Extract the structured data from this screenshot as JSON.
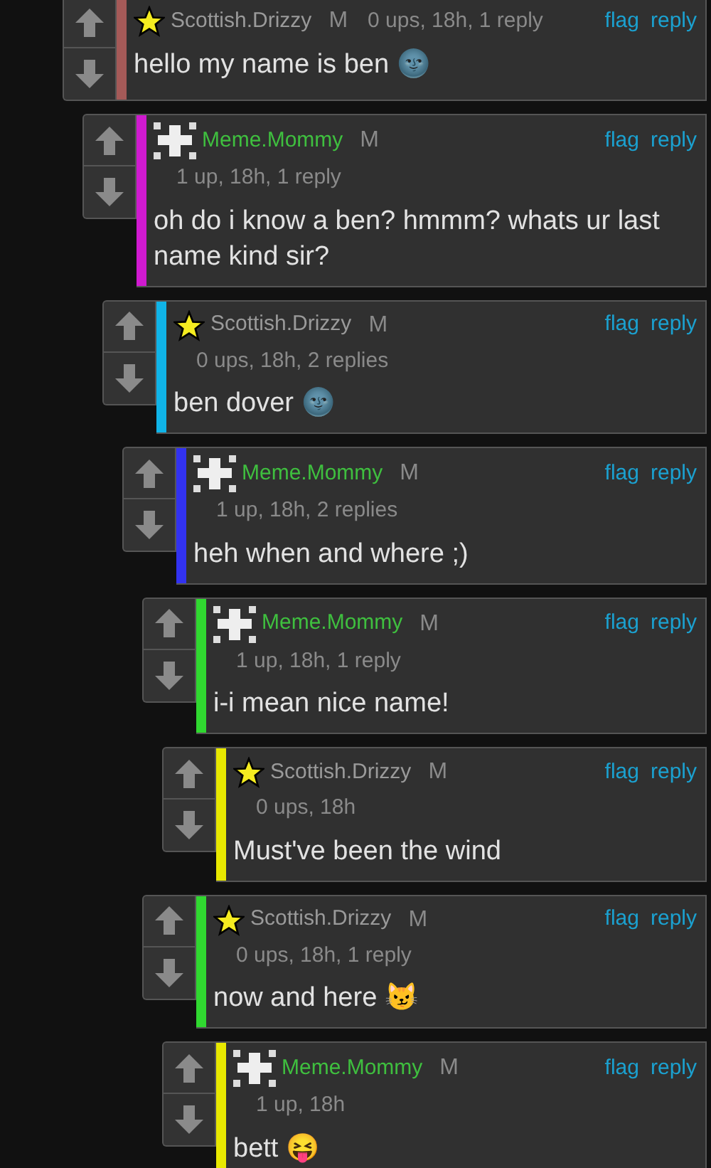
{
  "comments": [
    {
      "author": "Scottish.Drizzy",
      "avatar": {
        "kind": "star"
      },
      "tag": "M",
      "meta": "0 ups, 18h, 1 reply",
      "meta_inline": true,
      "color": "#a55a58",
      "text": "hello my name is ben 🌚",
      "actions": [
        "flag",
        "reply"
      ],
      "children": [
        {
          "author": "Meme.Mommy",
          "avatar": {
            "kind": "pixel"
          },
          "tag": "M",
          "meta": "1 up, 18h, 1 reply",
          "meta_inline": false,
          "color": "#d01ad0",
          "text": "oh do i know a ben? hmmm? whats ur last name kind sir?",
          "actions": [
            "flag",
            "reply"
          ],
          "children": [
            {
              "author": "Scottish.Drizzy",
              "avatar": {
                "kind": "star"
              },
              "tag": "M",
              "meta": "0 ups, 18h, 2 replies",
              "meta_inline": false,
              "color": "#10b4e8",
              "text": "ben dover 🌚",
              "actions": [
                "flag",
                "reply"
              ],
              "children": [
                {
                  "author": "Meme.Mommy",
                  "avatar": {
                    "kind": "pixel"
                  },
                  "tag": "M",
                  "meta": "1 up, 18h, 2 replies",
                  "meta_inline": false,
                  "color": "#3232f0",
                  "text": "heh when and where ;)",
                  "actions": [
                    "flag",
                    "reply"
                  ],
                  "children": [
                    {
                      "author": "Meme.Mommy",
                      "avatar": {
                        "kind": "pixel"
                      },
                      "tag": "M",
                      "meta": "1 up, 18h, 1 reply",
                      "meta_inline": false,
                      "color": "#30d830",
                      "text": "i-i mean nice name!",
                      "actions": [
                        "flag",
                        "reply"
                      ],
                      "children": [
                        {
                          "author": "Scottish.Drizzy",
                          "avatar": {
                            "kind": "star"
                          },
                          "tag": "M",
                          "meta": "0 ups, 18h",
                          "meta_inline": false,
                          "color": "#e8e800",
                          "text": "Must've been the wind",
                          "actions": [
                            "flag",
                            "reply"
                          ]
                        }
                      ]
                    },
                    {
                      "author": "Scottish.Drizzy",
                      "avatar": {
                        "kind": "star"
                      },
                      "tag": "M",
                      "meta": "0 ups, 18h, 1 reply",
                      "meta_inline": false,
                      "color": "#30d830",
                      "text": "now and here 😼",
                      "actions": [
                        "flag",
                        "reply"
                      ],
                      "children": [
                        {
                          "author": "Meme.Mommy",
                          "avatar": {
                            "kind": "pixel"
                          },
                          "tag": "M",
                          "meta": "1 up, 18h",
                          "meta_inline": false,
                          "color": "#e8e800",
                          "text": "bett 😝",
                          "actions": [
                            "flag",
                            "reply"
                          ]
                        }
                      ]
                    }
                  ]
                }
              ]
            }
          ]
        }
      ]
    }
  ]
}
